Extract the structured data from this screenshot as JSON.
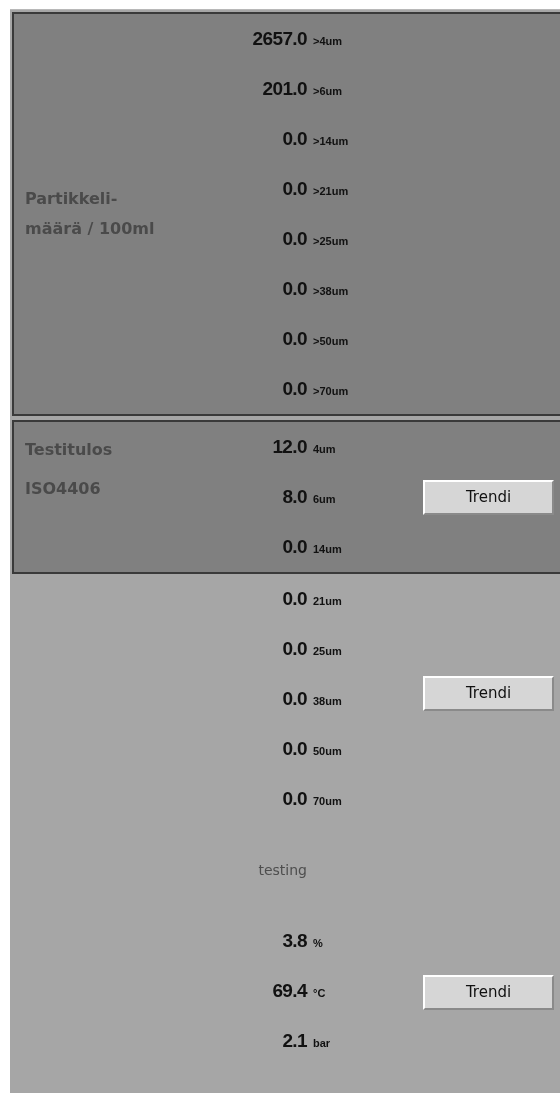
{
  "sections": [
    {
      "kind": "summary",
      "label": [
        "Partikkeli-",
        "määrä / 100ml"
      ],
      "readings": [
        {
          "value": "2657.0",
          "unit": ">4um"
        },
        {
          "value": "201.0",
          "unit": ">6um"
        },
        {
          "value": "0.0",
          "unit": ">14um"
        },
        {
          "value": "0.0",
          "unit": ">21um"
        },
        {
          "value": "0.0",
          "unit": ">25um"
        },
        {
          "value": "0.0",
          "unit": ">38um"
        },
        {
          "value": "0.0",
          "unit": ">50um"
        },
        {
          "value": "0.0",
          "unit": ">70um"
        }
      ]
    },
    {
      "kind": "result",
      "label": [
        "Testitulos",
        "ISO4406"
      ],
      "readings": [
        {
          "value": "12.0",
          "unit": "4um"
        },
        {
          "value": "8.0",
          "unit": "6um"
        },
        {
          "value": "0.0",
          "unit": "14um"
        }
      ],
      "button": "Trendi"
    },
    {
      "kind": "plain",
      "readings": [
        {
          "value": "0.0",
          "unit": "21um"
        },
        {
          "value": "0.0",
          "unit": "25um"
        },
        {
          "value": "0.0",
          "unit": "38um"
        },
        {
          "value": "0.0",
          "unit": "50um"
        },
        {
          "value": "0.0",
          "unit": "70um"
        }
      ],
      "button": "Trendi"
    },
    {
      "kind": "plain",
      "caption": "testing",
      "readings": [
        {
          "value": "3.8",
          "unit": "%"
        },
        {
          "value": "69.4",
          "unit": "°C"
        },
        {
          "value": "2.1",
          "unit": "bar"
        }
      ],
      "button": "Trendi"
    }
  ]
}
